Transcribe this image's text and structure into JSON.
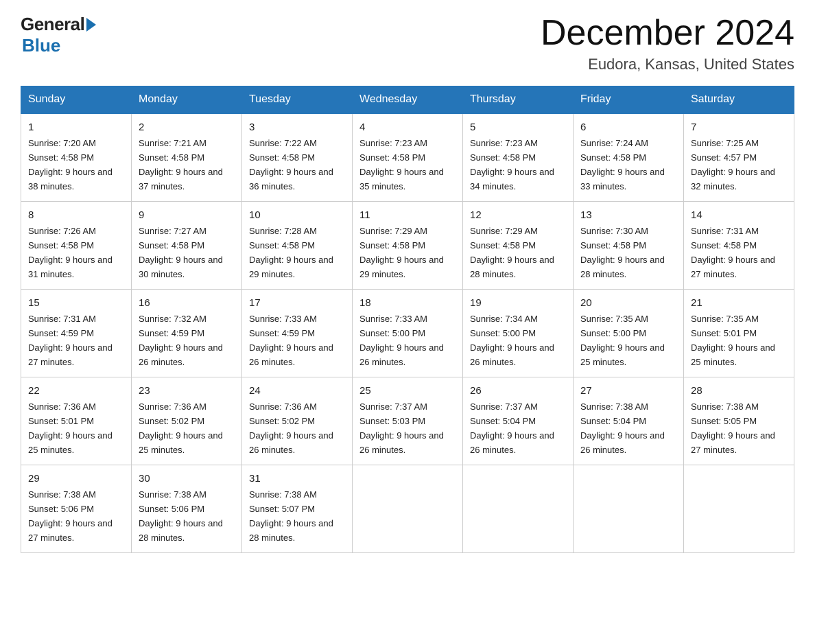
{
  "logo": {
    "text_general": "General",
    "text_blue": "Blue"
  },
  "title": "December 2024",
  "subtitle": "Eudora, Kansas, United States",
  "days_of_week": [
    "Sunday",
    "Monday",
    "Tuesday",
    "Wednesday",
    "Thursday",
    "Friday",
    "Saturday"
  ],
  "weeks": [
    [
      {
        "day": "1",
        "sunrise": "Sunrise: 7:20 AM",
        "sunset": "Sunset: 4:58 PM",
        "daylight": "Daylight: 9 hours and 38 minutes."
      },
      {
        "day": "2",
        "sunrise": "Sunrise: 7:21 AM",
        "sunset": "Sunset: 4:58 PM",
        "daylight": "Daylight: 9 hours and 37 minutes."
      },
      {
        "day": "3",
        "sunrise": "Sunrise: 7:22 AM",
        "sunset": "Sunset: 4:58 PM",
        "daylight": "Daylight: 9 hours and 36 minutes."
      },
      {
        "day": "4",
        "sunrise": "Sunrise: 7:23 AM",
        "sunset": "Sunset: 4:58 PM",
        "daylight": "Daylight: 9 hours and 35 minutes."
      },
      {
        "day": "5",
        "sunrise": "Sunrise: 7:23 AM",
        "sunset": "Sunset: 4:58 PM",
        "daylight": "Daylight: 9 hours and 34 minutes."
      },
      {
        "day": "6",
        "sunrise": "Sunrise: 7:24 AM",
        "sunset": "Sunset: 4:58 PM",
        "daylight": "Daylight: 9 hours and 33 minutes."
      },
      {
        "day": "7",
        "sunrise": "Sunrise: 7:25 AM",
        "sunset": "Sunset: 4:57 PM",
        "daylight": "Daylight: 9 hours and 32 minutes."
      }
    ],
    [
      {
        "day": "8",
        "sunrise": "Sunrise: 7:26 AM",
        "sunset": "Sunset: 4:58 PM",
        "daylight": "Daylight: 9 hours and 31 minutes."
      },
      {
        "day": "9",
        "sunrise": "Sunrise: 7:27 AM",
        "sunset": "Sunset: 4:58 PM",
        "daylight": "Daylight: 9 hours and 30 minutes."
      },
      {
        "day": "10",
        "sunrise": "Sunrise: 7:28 AM",
        "sunset": "Sunset: 4:58 PM",
        "daylight": "Daylight: 9 hours and 29 minutes."
      },
      {
        "day": "11",
        "sunrise": "Sunrise: 7:29 AM",
        "sunset": "Sunset: 4:58 PM",
        "daylight": "Daylight: 9 hours and 29 minutes."
      },
      {
        "day": "12",
        "sunrise": "Sunrise: 7:29 AM",
        "sunset": "Sunset: 4:58 PM",
        "daylight": "Daylight: 9 hours and 28 minutes."
      },
      {
        "day": "13",
        "sunrise": "Sunrise: 7:30 AM",
        "sunset": "Sunset: 4:58 PM",
        "daylight": "Daylight: 9 hours and 28 minutes."
      },
      {
        "day": "14",
        "sunrise": "Sunrise: 7:31 AM",
        "sunset": "Sunset: 4:58 PM",
        "daylight": "Daylight: 9 hours and 27 minutes."
      }
    ],
    [
      {
        "day": "15",
        "sunrise": "Sunrise: 7:31 AM",
        "sunset": "Sunset: 4:59 PM",
        "daylight": "Daylight: 9 hours and 27 minutes."
      },
      {
        "day": "16",
        "sunrise": "Sunrise: 7:32 AM",
        "sunset": "Sunset: 4:59 PM",
        "daylight": "Daylight: 9 hours and 26 minutes."
      },
      {
        "day": "17",
        "sunrise": "Sunrise: 7:33 AM",
        "sunset": "Sunset: 4:59 PM",
        "daylight": "Daylight: 9 hours and 26 minutes."
      },
      {
        "day": "18",
        "sunrise": "Sunrise: 7:33 AM",
        "sunset": "Sunset: 5:00 PM",
        "daylight": "Daylight: 9 hours and 26 minutes."
      },
      {
        "day": "19",
        "sunrise": "Sunrise: 7:34 AM",
        "sunset": "Sunset: 5:00 PM",
        "daylight": "Daylight: 9 hours and 26 minutes."
      },
      {
        "day": "20",
        "sunrise": "Sunrise: 7:35 AM",
        "sunset": "Sunset: 5:00 PM",
        "daylight": "Daylight: 9 hours and 25 minutes."
      },
      {
        "day": "21",
        "sunrise": "Sunrise: 7:35 AM",
        "sunset": "Sunset: 5:01 PM",
        "daylight": "Daylight: 9 hours and 25 minutes."
      }
    ],
    [
      {
        "day": "22",
        "sunrise": "Sunrise: 7:36 AM",
        "sunset": "Sunset: 5:01 PM",
        "daylight": "Daylight: 9 hours and 25 minutes."
      },
      {
        "day": "23",
        "sunrise": "Sunrise: 7:36 AM",
        "sunset": "Sunset: 5:02 PM",
        "daylight": "Daylight: 9 hours and 25 minutes."
      },
      {
        "day": "24",
        "sunrise": "Sunrise: 7:36 AM",
        "sunset": "Sunset: 5:02 PM",
        "daylight": "Daylight: 9 hours and 26 minutes."
      },
      {
        "day": "25",
        "sunrise": "Sunrise: 7:37 AM",
        "sunset": "Sunset: 5:03 PM",
        "daylight": "Daylight: 9 hours and 26 minutes."
      },
      {
        "day": "26",
        "sunrise": "Sunrise: 7:37 AM",
        "sunset": "Sunset: 5:04 PM",
        "daylight": "Daylight: 9 hours and 26 minutes."
      },
      {
        "day": "27",
        "sunrise": "Sunrise: 7:38 AM",
        "sunset": "Sunset: 5:04 PM",
        "daylight": "Daylight: 9 hours and 26 minutes."
      },
      {
        "day": "28",
        "sunrise": "Sunrise: 7:38 AM",
        "sunset": "Sunset: 5:05 PM",
        "daylight": "Daylight: 9 hours and 27 minutes."
      }
    ],
    [
      {
        "day": "29",
        "sunrise": "Sunrise: 7:38 AM",
        "sunset": "Sunset: 5:06 PM",
        "daylight": "Daylight: 9 hours and 27 minutes."
      },
      {
        "day": "30",
        "sunrise": "Sunrise: 7:38 AM",
        "sunset": "Sunset: 5:06 PM",
        "daylight": "Daylight: 9 hours and 28 minutes."
      },
      {
        "day": "31",
        "sunrise": "Sunrise: 7:38 AM",
        "sunset": "Sunset: 5:07 PM",
        "daylight": "Daylight: 9 hours and 28 minutes."
      },
      null,
      null,
      null,
      null
    ]
  ]
}
